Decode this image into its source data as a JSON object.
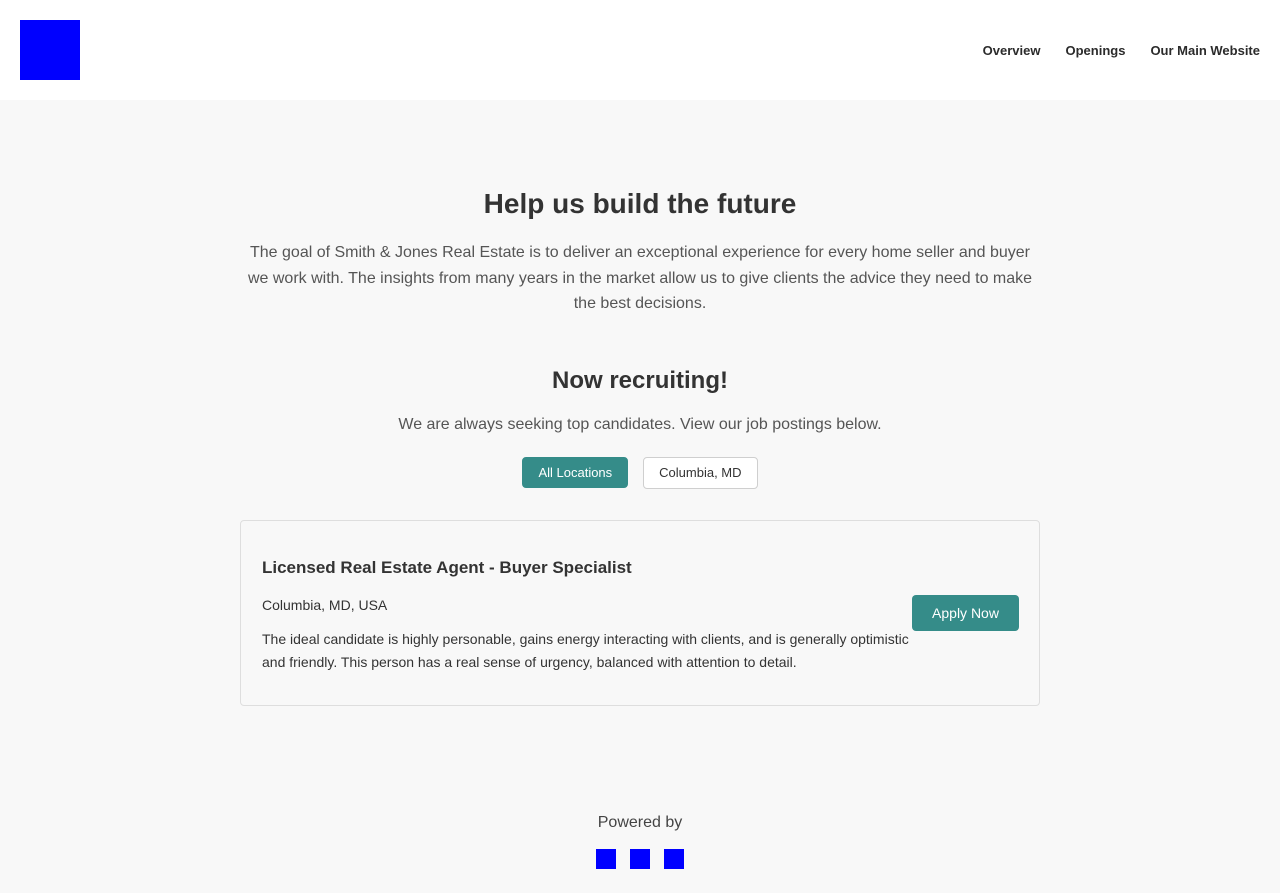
{
  "header": {
    "logo_color": "#0000ff",
    "nav": [
      {
        "label": "Overview"
      },
      {
        "label": "Openings"
      },
      {
        "label": "Our Main Website"
      }
    ]
  },
  "hero": {
    "title": "Help us build the future",
    "text": "The goal of Smith & Jones Real Estate is to deliver an exceptional experience for every home seller and buyer we work with. The insights from many years in the market allow us to give clients the advice they need to make the best decisions."
  },
  "recruiting": {
    "title": "Now recruiting!",
    "text": "We are always seeking top candidates. View our job postings below.",
    "filters": [
      {
        "label": "All Locations",
        "active": true
      },
      {
        "label": "Columbia, MD",
        "active": false
      }
    ]
  },
  "jobs": [
    {
      "title": "Licensed Real Estate Agent - Buyer Specialist",
      "location": "Columbia, MD, USA",
      "description": "The ideal candidate is highly personable, gains energy interacting with clients, and is generally optimistic and friendly. This person has a real sense of urgency, balanced with attention to detail.",
      "apply_label": "Apply Now"
    }
  ],
  "footer": {
    "powered_by": "Powered by",
    "social_icons": [
      "social-icon",
      "social-icon",
      "social-icon"
    ]
  },
  "colors": {
    "accent": "#358c89",
    "placeholder_blue": "#0000ff",
    "background": "#f8f8f8"
  }
}
